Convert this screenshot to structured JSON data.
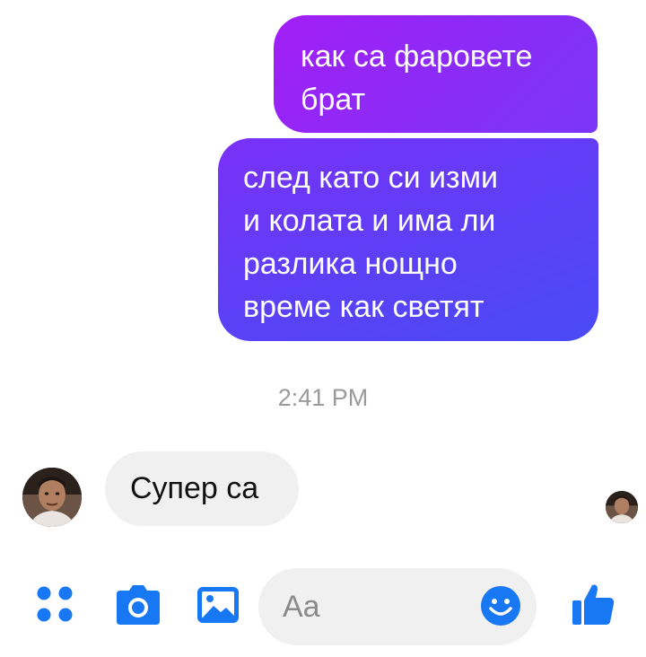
{
  "conversation": {
    "outgoing": [
      {
        "text": "как са фаровете\nбрат"
      },
      {
        "text": "след като си изми\nи колата и има ли\nразлика нощно\nвреме как светят"
      }
    ],
    "timestamp": "2:41 PM",
    "incoming": [
      {
        "text": "Супер са"
      }
    ]
  },
  "composer": {
    "placeholder": "Aa"
  },
  "icons": {
    "menu": "four-dots-icon",
    "camera": "camera-icon",
    "gallery": "image-icon",
    "emoji": "smiley-icon",
    "like": "thumbs-up-icon"
  },
  "colors": {
    "accent": "#1877f2",
    "bubble_out_top": "#a21ff6",
    "bubble_out_bottom": "#4a4bf7",
    "bubble_in": "#f0f0f0",
    "timestamp": "#9a9a9a"
  }
}
